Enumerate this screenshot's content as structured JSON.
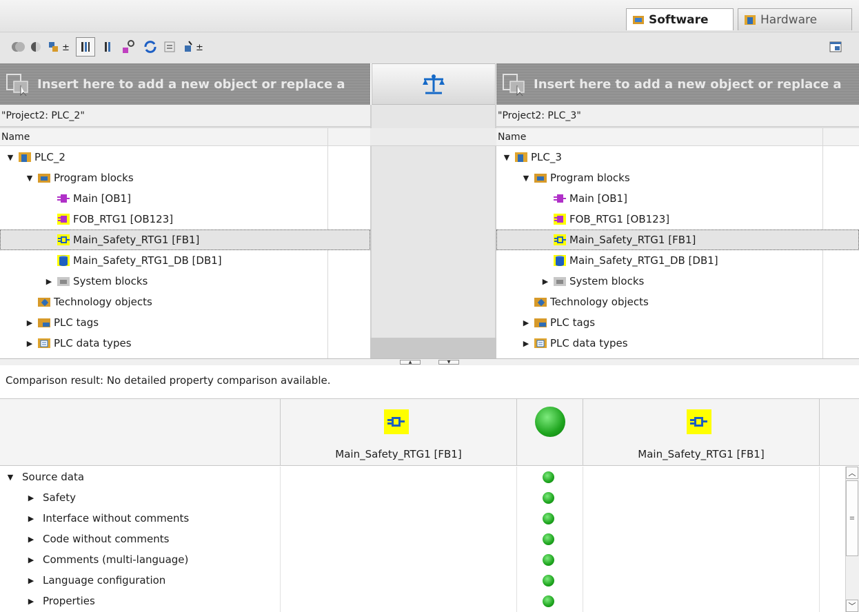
{
  "tabs": {
    "software": "Software",
    "hardware": "Hardware"
  },
  "insert_hint": "Insert here to add a new object or replace a",
  "left": {
    "project": "\"Project2: PLC_2\"",
    "column": "Name",
    "tree": [
      {
        "label": "PLC_2",
        "level": 0,
        "arrow": "▼",
        "icon": "plc-icon"
      },
      {
        "label": "Program blocks",
        "level": 1,
        "arrow": "▼",
        "icon": "program-blocks-icon"
      },
      {
        "label": "Main [OB1]",
        "level": 2,
        "arrow": "",
        "icon": "ob-icon"
      },
      {
        "label": "FOB_RTG1 [OB123]",
        "level": 2,
        "arrow": "",
        "icon": "fob-icon"
      },
      {
        "label": "Main_Safety_RTG1 [FB1]",
        "level": 2,
        "arrow": "",
        "icon": "fb-icon",
        "selected": true
      },
      {
        "label": "Main_Safety_RTG1_DB [DB1]",
        "level": 2,
        "arrow": "",
        "icon": "db-icon"
      },
      {
        "label": "System blocks",
        "level": 2,
        "arrow": "▶",
        "icon": "system-blocks-icon"
      },
      {
        "label": "Technology objects",
        "level": 1,
        "arrow": "",
        "icon": "technology-objects-icon"
      },
      {
        "label": "PLC tags",
        "level": 1,
        "arrow": "▶",
        "icon": "plc-tags-icon"
      },
      {
        "label": "PLC data types",
        "level": 1,
        "arrow": "▶",
        "icon": "plc-data-types-icon"
      }
    ]
  },
  "right": {
    "project": "\"Project2: PLC_3\"",
    "column": "Name",
    "tree": [
      {
        "label": "PLC_3",
        "level": 0,
        "arrow": "▼",
        "icon": "plc-icon"
      },
      {
        "label": "Program blocks",
        "level": 1,
        "arrow": "▼",
        "icon": "program-blocks-icon"
      },
      {
        "label": "Main [OB1]",
        "level": 2,
        "arrow": "",
        "icon": "ob-icon"
      },
      {
        "label": "FOB_RTG1 [OB123]",
        "level": 2,
        "arrow": "",
        "icon": "fob-icon"
      },
      {
        "label": "Main_Safety_RTG1 [FB1]",
        "level": 2,
        "arrow": "",
        "icon": "fb-icon",
        "selected": true
      },
      {
        "label": "Main_Safety_RTG1_DB [DB1]",
        "level": 2,
        "arrow": "",
        "icon": "db-icon"
      },
      {
        "label": "System blocks",
        "level": 2,
        "arrow": "▶",
        "icon": "system-blocks-icon"
      },
      {
        "label": "Technology objects",
        "level": 1,
        "arrow": "",
        "icon": "technology-objects-icon"
      },
      {
        "label": "PLC tags",
        "level": 1,
        "arrow": "▶",
        "icon": "plc-tags-icon"
      },
      {
        "label": "PLC data types",
        "level": 1,
        "arrow": "▶",
        "icon": "plc-data-types-icon"
      }
    ]
  },
  "comparison": {
    "result": "Comparison result: No detailed property comparison available.",
    "left_object": "Main_Safety_RTG1 [FB1]",
    "right_object": "Main_Safety_RTG1 [FB1]",
    "status_color": "#22aa22",
    "properties": [
      {
        "label": "Source data",
        "arrow": "▼",
        "level": 0
      },
      {
        "label": "Safety",
        "arrow": "▶",
        "level": 1
      },
      {
        "label": "Interface without comments",
        "arrow": "▶",
        "level": 1
      },
      {
        "label": "Code without comments",
        "arrow": "▶",
        "level": 1
      },
      {
        "label": "Comments (multi-language)",
        "arrow": "▶",
        "level": 1
      },
      {
        "label": "Language configuration",
        "arrow": "▶",
        "level": 1
      },
      {
        "label": "Properties",
        "arrow": "▶",
        "level": 1
      }
    ]
  }
}
